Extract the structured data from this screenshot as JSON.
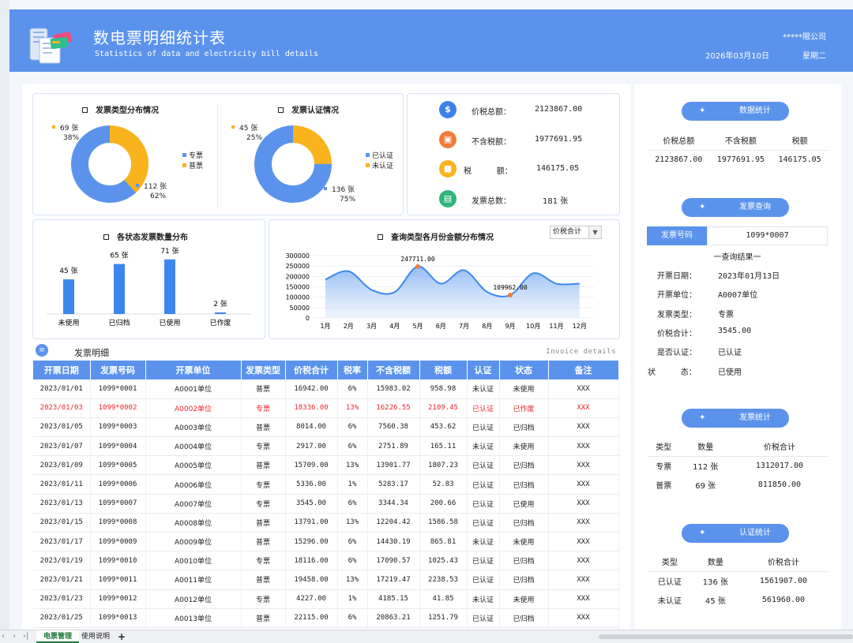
{
  "header": {
    "title": "数电票明细统计表",
    "subtitle": "Statistics of data and electricity bill details",
    "company": "*****限公司",
    "date": "2026年03月10日",
    "weekday": "星期二"
  },
  "colors": {
    "accent": "#5b93ec",
    "orange": "#f8b31d",
    "red": "#e8262e"
  },
  "invoice_type_chart": {
    "title": "发票类型分布情况",
    "legend": [
      "专票",
      "普票"
    ],
    "labels": [
      {
        "count": "112 张",
        "pct": "62%"
      },
      {
        "count": "69 张",
        "pct": "38%"
      }
    ]
  },
  "cert_chart": {
    "title": "发票认证情况",
    "legend": [
      "已认证",
      "未认证"
    ],
    "labels": [
      {
        "count": "136 张",
        "pct": "75%"
      },
      {
        "count": "45 张",
        "pct": "25%"
      }
    ]
  },
  "summary": {
    "tax_total_label": "价税总额：",
    "tax_total": "2123867.00",
    "no_tax_label": "不含税额：",
    "no_tax": "1977691.95",
    "tax_label": "税          额：",
    "tax": "146175.05",
    "count_label": "发票总数：",
    "count": "181 张",
    "icons": [
      "dollar-icon",
      "receipt-icon",
      "coin-icon",
      "document-icon"
    ]
  },
  "status_chart": {
    "title": "各状态发票数量分布",
    "labels": [
      "45 张",
      "65 张",
      "71 张",
      "2 张"
    ]
  },
  "monthly_chart": {
    "title": "查询类型各月份金额分布情况",
    "dropdown": "价税合计",
    "peak_label": "247711.00",
    "low_label": "109962.00"
  },
  "chart_data": [
    {
      "type": "pie",
      "title": "发票类型分布情况",
      "categories": [
        "专票",
        "普票"
      ],
      "values": [
        112,
        69
      ]
    },
    {
      "type": "pie",
      "title": "发票认证情况",
      "categories": [
        "已认证",
        "未认证"
      ],
      "values": [
        136,
        45
      ]
    },
    {
      "type": "bar",
      "title": "各状态发票数量分布",
      "categories": [
        "未使用",
        "已归档",
        "已使用",
        "已作废"
      ],
      "values": [
        45,
        65,
        71,
        2
      ],
      "ylim": [
        0,
        80
      ]
    },
    {
      "type": "area",
      "title": "查询类型各月份金额分布情况",
      "categories": [
        "1月",
        "2月",
        "3月",
        "4月",
        "5月",
        "6月",
        "7月",
        "8月",
        "9月",
        "10月",
        "11月",
        "12月"
      ],
      "values": [
        185000,
        225000,
        135000,
        125000,
        247711,
        165000,
        230000,
        125000,
        109962,
        215000,
        165000,
        165000
      ],
      "yticks": [
        "0",
        "50000",
        "100000",
        "150000",
        "200000",
        "250000",
        "300000"
      ],
      "ylim": [
        0,
        300000
      ],
      "grid": true
    }
  ],
  "detail": {
    "section_title": "发票明细",
    "section_en": "Invoice details",
    "columns": [
      "开票日期",
      "发票号码",
      "开票单位",
      "发票类型",
      "价税合计",
      "税率",
      "不含税额",
      "税额",
      "认证",
      "状态",
      "备注"
    ],
    "rows": [
      [
        "2023/01/01",
        "1099*0001",
        "A0001单位",
        "普票",
        "16942.00",
        "6%",
        "15983.02",
        "958.98",
        "未认证",
        "未使用",
        "XXX"
      ],
      [
        "2023/01/03",
        "1099*0002",
        "A0002单位",
        "专票",
        "18336.00",
        "13%",
        "16226.55",
        "2109.45",
        "已认证",
        "已作废",
        "XXX"
      ],
      [
        "2023/01/05",
        "1099*0003",
        "A0003单位",
        "普票",
        "8014.00",
        "6%",
        "7560.38",
        "453.62",
        "已认证",
        "已归档",
        "XXX"
      ],
      [
        "2023/01/07",
        "1099*0004",
        "A0004单位",
        "专票",
        "2917.00",
        "6%",
        "2751.89",
        "165.11",
        "未认证",
        "未使用",
        "XXX"
      ],
      [
        "2023/01/09",
        "1099*0005",
        "A0005单位",
        "普票",
        "15709.00",
        "13%",
        "13901.77",
        "1807.23",
        "已认证",
        "已归档",
        "XXX"
      ],
      [
        "2023/01/11",
        "1099*0006",
        "A0006单位",
        "专票",
        "5336.00",
        "1%",
        "5283.17",
        "52.83",
        "已认证",
        "已归档",
        "XXX"
      ],
      [
        "2023/01/13",
        "1099*0007",
        "A0007单位",
        "专票",
        "3545.00",
        "6%",
        "3344.34",
        "200.66",
        "已认证",
        "已使用",
        "XXX"
      ],
      [
        "2023/01/15",
        "1099*0008",
        "A0008单位",
        "普票",
        "13791.00",
        "13%",
        "12204.42",
        "1586.58",
        "已认证",
        "已归档",
        "XXX"
      ],
      [
        "2023/01/17",
        "1099*0009",
        "A0009单位",
        "普票",
        "15296.00",
        "6%",
        "14430.19",
        "865.81",
        "未认证",
        "未使用",
        "XXX"
      ],
      [
        "2023/01/19",
        "1099*0010",
        "A0010单位",
        "专票",
        "18116.00",
        "6%",
        "17090.57",
        "1025.43",
        "已认证",
        "已归档",
        "XXX"
      ],
      [
        "2023/01/21",
        "1099*0011",
        "A0011单位",
        "普票",
        "19458.00",
        "13%",
        "17219.47",
        "2238.53",
        "已认证",
        "已归档",
        "XXX"
      ],
      [
        "2023/01/23",
        "1099*0012",
        "A0012单位",
        "专票",
        "4227.00",
        "1%",
        "4185.15",
        "41.85",
        "未认证",
        "未使用",
        "XXX"
      ],
      [
        "2023/01/25",
        "1099*0013",
        "A0013单位",
        "普票",
        "22115.00",
        "6%",
        "20863.21",
        "1251.79",
        "已认证",
        "已归档",
        "XXX"
      ]
    ]
  },
  "side": {
    "data_stats": {
      "title": "数据统计",
      "headers": [
        "价税总额",
        "不含税额",
        "税额"
      ],
      "values": [
        "2123867.00",
        "1977691.95",
        "146175.05"
      ]
    },
    "query": {
      "title": "发票查询",
      "key": "发票号码",
      "value": "1099*0007",
      "result_title": "一查询结果一",
      "lines": [
        {
          "label": "开票日期：",
          "value": "2023年01月13日"
        },
        {
          "label": "开票单位：",
          "value": "A0007单位"
        },
        {
          "label": "发票类型：",
          "value": "专票"
        },
        {
          "label": "价税合计：",
          "value": "3545.00"
        },
        {
          "label": "是否认证：",
          "value": "已认证"
        },
        {
          "label": "状          态：",
          "value": "已使用"
        }
      ]
    },
    "invoice_stats": {
      "title": "发票统计",
      "headers": [
        "类型",
        "数量",
        "价税合计"
      ],
      "rows": [
        [
          "专票",
          "112 张",
          "1312017.00"
        ],
        [
          "普票",
          "69 张",
          "811850.00"
        ]
      ]
    },
    "cert_stats": {
      "title": "认证统计",
      "headers": [
        "类型",
        "数量",
        "价税合计"
      ],
      "rows": [
        [
          "已认证",
          "136 张",
          "1561907.00"
        ],
        [
          "未认证",
          "45 张",
          "561960.00"
        ]
      ]
    }
  },
  "tabs": [
    "电票管理",
    "使用说明"
  ],
  "add_tab": "+"
}
